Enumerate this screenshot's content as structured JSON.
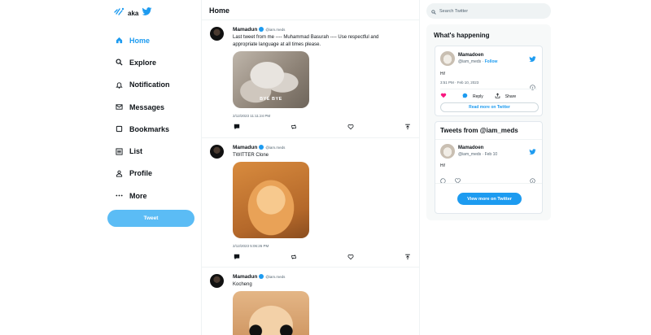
{
  "brand": {
    "text": "aka"
  },
  "nav": [
    {
      "label": "Home",
      "icon": "home-icon"
    },
    {
      "label": "Explore",
      "icon": "search-icon"
    },
    {
      "label": "Notification",
      "icon": "bell-icon"
    },
    {
      "label": "Messages",
      "icon": "mail-icon"
    },
    {
      "label": "Bookmarks",
      "icon": "bookmark-icon"
    },
    {
      "label": "List",
      "icon": "list-icon"
    },
    {
      "label": "Profile",
      "icon": "person-icon"
    },
    {
      "label": "More",
      "icon": "more-icon"
    }
  ],
  "tweet_button": "Tweet",
  "feed": {
    "title": "Home",
    "tweets": [
      {
        "name": "Mamadun",
        "handle": "@iam.meds",
        "text": "Last tweet from me ---- Muhammad Basurah ---- Use respectful and appropriate language at all times please.",
        "media_caption": "BYE BYE",
        "time": "2/12/2023 11:11:24 PM"
      },
      {
        "name": "Mamadun",
        "handle": "@iam.meds",
        "text": "TWITTER Clone",
        "media_caption": "",
        "time": "2/12/2023 5:06:26 PM"
      },
      {
        "name": "Mamadun",
        "handle": "@iam.meds",
        "text": "Kocheng",
        "media_caption": "",
        "time": ""
      }
    ]
  },
  "search": {
    "placeholder": "Search Twitter"
  },
  "whats_happening": {
    "title": "What's happening",
    "card": {
      "name": "Mamadoen",
      "handle": "@iam_meds",
      "separator": " · ",
      "follow": "Follow",
      "text": "Hi!",
      "time": "3:51 PM · Feb 10, 2023",
      "reply": "Reply",
      "share": "Share",
      "read_more": "Read more on Twitter"
    }
  },
  "tweets_from": {
    "title": "Tweets from @iam_meds",
    "card": {
      "name": "Mamadoen",
      "handle": "@iam_meds · Feb 10",
      "text": "Hi!"
    },
    "view_more": "View more on Twitter"
  },
  "colors": {
    "accent": "#1d9bf0",
    "tweet_button": "#5bbcf5",
    "like": "#f91880"
  }
}
